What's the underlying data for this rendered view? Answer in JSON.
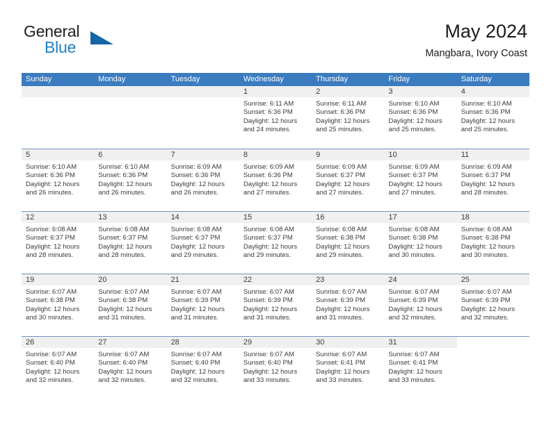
{
  "brand": {
    "name_part1": "General",
    "name_part2": "Blue",
    "triangle_color": "#1565a8",
    "blue_color": "#1f7fc4"
  },
  "header": {
    "title": "May 2024",
    "location": "Mangbara, Ivory Coast"
  },
  "theme": {
    "header_row_bg": "#3b7cc0",
    "day_number_bg": "#f0f0f0",
    "week_divider": "#6f93bb",
    "text": "#3a3a3a"
  },
  "weekdays": [
    "Sunday",
    "Monday",
    "Tuesday",
    "Wednesday",
    "Thursday",
    "Friday",
    "Saturday"
  ],
  "weeks": [
    [
      {
        "day": "",
        "sunrise": "",
        "sunset": "",
        "daylight_line1": "",
        "daylight_line2": "",
        "empty": true
      },
      {
        "day": "",
        "sunrise": "",
        "sunset": "",
        "daylight_line1": "",
        "daylight_line2": "",
        "empty": true
      },
      {
        "day": "",
        "sunrise": "",
        "sunset": "",
        "daylight_line1": "",
        "daylight_line2": "",
        "empty": true
      },
      {
        "day": "1",
        "sunrise": "Sunrise: 6:11 AM",
        "sunset": "Sunset: 6:36 PM",
        "daylight_line1": "Daylight: 12 hours",
        "daylight_line2": "and 24 minutes."
      },
      {
        "day": "2",
        "sunrise": "Sunrise: 6:11 AM",
        "sunset": "Sunset: 6:36 PM",
        "daylight_line1": "Daylight: 12 hours",
        "daylight_line2": "and 25 minutes."
      },
      {
        "day": "3",
        "sunrise": "Sunrise: 6:10 AM",
        "sunset": "Sunset: 6:36 PM",
        "daylight_line1": "Daylight: 12 hours",
        "daylight_line2": "and 25 minutes."
      },
      {
        "day": "4",
        "sunrise": "Sunrise: 6:10 AM",
        "sunset": "Sunset: 6:36 PM",
        "daylight_line1": "Daylight: 12 hours",
        "daylight_line2": "and 25 minutes."
      }
    ],
    [
      {
        "day": "5",
        "sunrise": "Sunrise: 6:10 AM",
        "sunset": "Sunset: 6:36 PM",
        "daylight_line1": "Daylight: 12 hours",
        "daylight_line2": "and 26 minutes."
      },
      {
        "day": "6",
        "sunrise": "Sunrise: 6:10 AM",
        "sunset": "Sunset: 6:36 PM",
        "daylight_line1": "Daylight: 12 hours",
        "daylight_line2": "and 26 minutes."
      },
      {
        "day": "7",
        "sunrise": "Sunrise: 6:09 AM",
        "sunset": "Sunset: 6:36 PM",
        "daylight_line1": "Daylight: 12 hours",
        "daylight_line2": "and 26 minutes."
      },
      {
        "day": "8",
        "sunrise": "Sunrise: 6:09 AM",
        "sunset": "Sunset: 6:36 PM",
        "daylight_line1": "Daylight: 12 hours",
        "daylight_line2": "and 27 minutes."
      },
      {
        "day": "9",
        "sunrise": "Sunrise: 6:09 AM",
        "sunset": "Sunset: 6:37 PM",
        "daylight_line1": "Daylight: 12 hours",
        "daylight_line2": "and 27 minutes."
      },
      {
        "day": "10",
        "sunrise": "Sunrise: 6:09 AM",
        "sunset": "Sunset: 6:37 PM",
        "daylight_line1": "Daylight: 12 hours",
        "daylight_line2": "and 27 minutes."
      },
      {
        "day": "11",
        "sunrise": "Sunrise: 6:09 AM",
        "sunset": "Sunset: 6:37 PM",
        "daylight_line1": "Daylight: 12 hours",
        "daylight_line2": "and 28 minutes."
      }
    ],
    [
      {
        "day": "12",
        "sunrise": "Sunrise: 6:08 AM",
        "sunset": "Sunset: 6:37 PM",
        "daylight_line1": "Daylight: 12 hours",
        "daylight_line2": "and 28 minutes."
      },
      {
        "day": "13",
        "sunrise": "Sunrise: 6:08 AM",
        "sunset": "Sunset: 6:37 PM",
        "daylight_line1": "Daylight: 12 hours",
        "daylight_line2": "and 28 minutes."
      },
      {
        "day": "14",
        "sunrise": "Sunrise: 6:08 AM",
        "sunset": "Sunset: 6:37 PM",
        "daylight_line1": "Daylight: 12 hours",
        "daylight_line2": "and 29 minutes."
      },
      {
        "day": "15",
        "sunrise": "Sunrise: 6:08 AM",
        "sunset": "Sunset: 6:37 PM",
        "daylight_line1": "Daylight: 12 hours",
        "daylight_line2": "and 29 minutes."
      },
      {
        "day": "16",
        "sunrise": "Sunrise: 6:08 AM",
        "sunset": "Sunset: 6:38 PM",
        "daylight_line1": "Daylight: 12 hours",
        "daylight_line2": "and 29 minutes."
      },
      {
        "day": "17",
        "sunrise": "Sunrise: 6:08 AM",
        "sunset": "Sunset: 6:38 PM",
        "daylight_line1": "Daylight: 12 hours",
        "daylight_line2": "and 30 minutes."
      },
      {
        "day": "18",
        "sunrise": "Sunrise: 6:08 AM",
        "sunset": "Sunset: 6:38 PM",
        "daylight_line1": "Daylight: 12 hours",
        "daylight_line2": "and 30 minutes."
      }
    ],
    [
      {
        "day": "19",
        "sunrise": "Sunrise: 6:07 AM",
        "sunset": "Sunset: 6:38 PM",
        "daylight_line1": "Daylight: 12 hours",
        "daylight_line2": "and 30 minutes."
      },
      {
        "day": "20",
        "sunrise": "Sunrise: 6:07 AM",
        "sunset": "Sunset: 6:38 PM",
        "daylight_line1": "Daylight: 12 hours",
        "daylight_line2": "and 31 minutes."
      },
      {
        "day": "21",
        "sunrise": "Sunrise: 6:07 AM",
        "sunset": "Sunset: 6:39 PM",
        "daylight_line1": "Daylight: 12 hours",
        "daylight_line2": "and 31 minutes."
      },
      {
        "day": "22",
        "sunrise": "Sunrise: 6:07 AM",
        "sunset": "Sunset: 6:39 PM",
        "daylight_line1": "Daylight: 12 hours",
        "daylight_line2": "and 31 minutes."
      },
      {
        "day": "23",
        "sunrise": "Sunrise: 6:07 AM",
        "sunset": "Sunset: 6:39 PM",
        "daylight_line1": "Daylight: 12 hours",
        "daylight_line2": "and 31 minutes."
      },
      {
        "day": "24",
        "sunrise": "Sunrise: 6:07 AM",
        "sunset": "Sunset: 6:39 PM",
        "daylight_line1": "Daylight: 12 hours",
        "daylight_line2": "and 32 minutes."
      },
      {
        "day": "25",
        "sunrise": "Sunrise: 6:07 AM",
        "sunset": "Sunset: 6:39 PM",
        "daylight_line1": "Daylight: 12 hours",
        "daylight_line2": "and 32 minutes."
      }
    ],
    [
      {
        "day": "26",
        "sunrise": "Sunrise: 6:07 AM",
        "sunset": "Sunset: 6:40 PM",
        "daylight_line1": "Daylight: 12 hours",
        "daylight_line2": "and 32 minutes."
      },
      {
        "day": "27",
        "sunrise": "Sunrise: 6:07 AM",
        "sunset": "Sunset: 6:40 PM",
        "daylight_line1": "Daylight: 12 hours",
        "daylight_line2": "and 32 minutes."
      },
      {
        "day": "28",
        "sunrise": "Sunrise: 6:07 AM",
        "sunset": "Sunset: 6:40 PM",
        "daylight_line1": "Daylight: 12 hours",
        "daylight_line2": "and 32 minutes."
      },
      {
        "day": "29",
        "sunrise": "Sunrise: 6:07 AM",
        "sunset": "Sunset: 6:40 PM",
        "daylight_line1": "Daylight: 12 hours",
        "daylight_line2": "and 33 minutes."
      },
      {
        "day": "30",
        "sunrise": "Sunrise: 6:07 AM",
        "sunset": "Sunset: 6:41 PM",
        "daylight_line1": "Daylight: 12 hours",
        "daylight_line2": "and 33 minutes."
      },
      {
        "day": "31",
        "sunrise": "Sunrise: 6:07 AM",
        "sunset": "Sunset: 6:41 PM",
        "daylight_line1": "Daylight: 12 hours",
        "daylight_line2": "and 33 minutes."
      },
      {
        "day": "",
        "sunrise": "",
        "sunset": "",
        "daylight_line1": "",
        "daylight_line2": "",
        "empty": true,
        "nonum": true
      }
    ]
  ]
}
